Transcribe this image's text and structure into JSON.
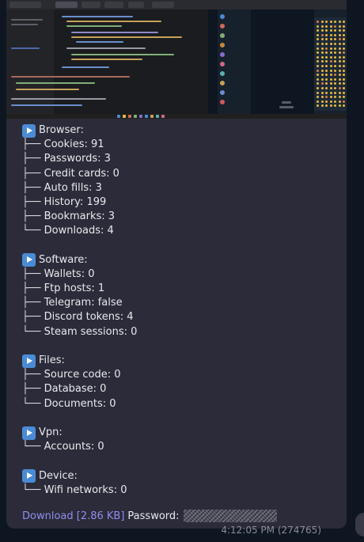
{
  "browser": {
    "title": "Browser:",
    "items": [
      {
        "branch": "├── ",
        "label": "Cookies: 91"
      },
      {
        "branch": "├── ",
        "label": "Passwords: 3"
      },
      {
        "branch": "├── ",
        "label": "Credit cards: 0"
      },
      {
        "branch": "├── ",
        "label": "Auto fills: 3"
      },
      {
        "branch": "├── ",
        "label": "History: 199"
      },
      {
        "branch": "├── ",
        "label": "Bookmarks: 3"
      },
      {
        "branch": "└── ",
        "label": "Downloads: 4"
      }
    ]
  },
  "software": {
    "title": "Software:",
    "items": [
      {
        "branch": "├── ",
        "label": "Wallets: 0"
      },
      {
        "branch": "├── ",
        "label": "Ftp hosts: 1"
      },
      {
        "branch": "├── ",
        "label": "Telegram: false"
      },
      {
        "branch": "├── ",
        "label": "Discord tokens: 4"
      },
      {
        "branch": "└── ",
        "label": "Steam sessions: 0"
      }
    ]
  },
  "files": {
    "title": "Files:",
    "items": [
      {
        "branch": "├── ",
        "label": "Source code: 0"
      },
      {
        "branch": "├── ",
        "label": "Database: 0"
      },
      {
        "branch": "└── ",
        "label": "Documents: 0"
      }
    ]
  },
  "vpn": {
    "title": "Vpn:",
    "items": [
      {
        "branch": "└── ",
        "label": "Accounts: 0"
      }
    ]
  },
  "device": {
    "title": "Device:",
    "items": [
      {
        "branch": "└── ",
        "label": "Wifi networks: 0"
      }
    ]
  },
  "footer": {
    "download_label": "Download [2.86 KB]",
    "password_label": "Password:"
  },
  "message": {
    "time": "4:12:05 PM (274765)"
  },
  "icons": {
    "section": "play-button-icon",
    "scroll": "scroll-down-button"
  },
  "colors": {
    "bubble": "#2b2b39",
    "link": "#8f8ef0",
    "section_icon": "#4a8bd6"
  }
}
